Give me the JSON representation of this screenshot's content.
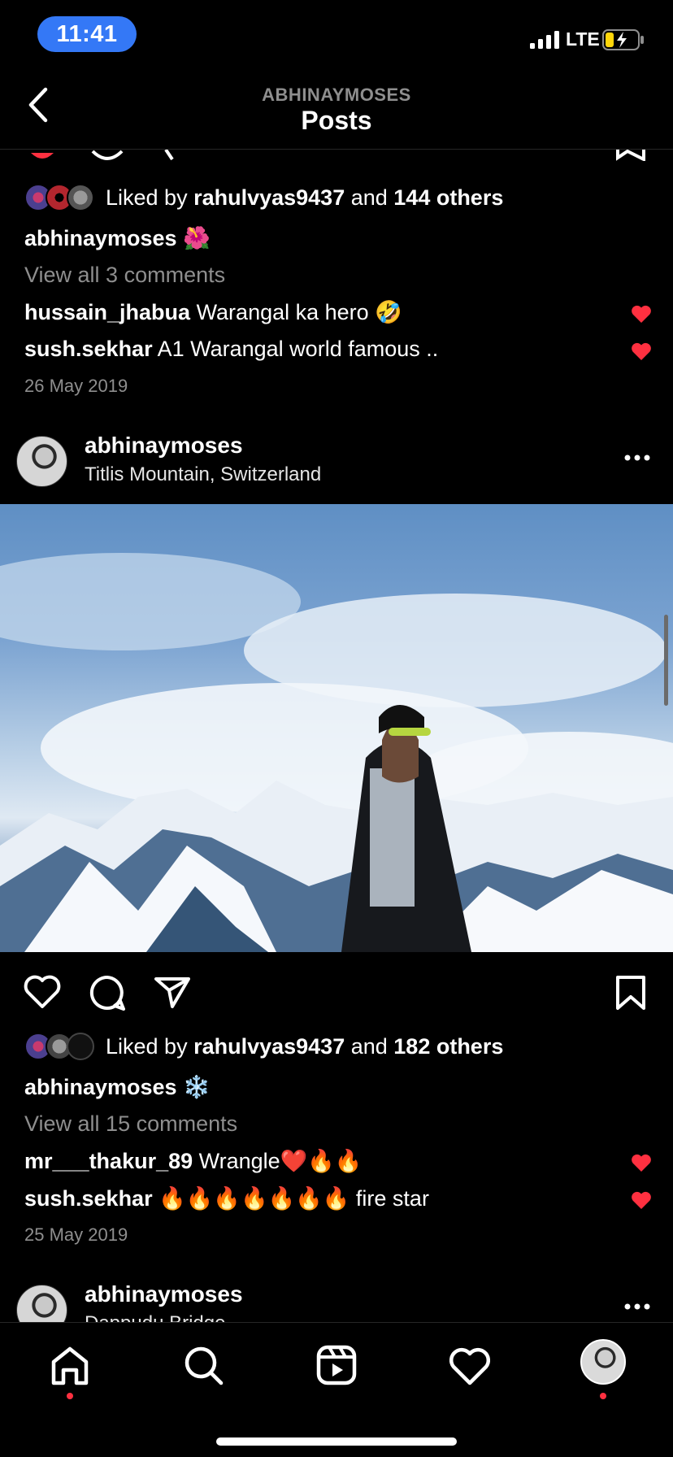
{
  "status": {
    "time": "11:41",
    "network": "LTE"
  },
  "nav": {
    "subtitle": "ABHINAYMOSES",
    "title": "Posts"
  },
  "post1": {
    "likes": {
      "prefix": "Liked by ",
      "user": "rahulvyas9437",
      "middle": " and ",
      "others": "144 others"
    },
    "caption": {
      "user": "abhinaymoses",
      "text": " 🌺"
    },
    "view_comments": "View all 3 comments",
    "comments": [
      {
        "user": "hussain_jhabua",
        "text": " Warangal ka hero 🤣"
      },
      {
        "user": "sush.sekhar",
        "text": " A1 Warangal world famous .."
      }
    ],
    "date": "26 May 2019"
  },
  "post2": {
    "user": "abhinaymoses",
    "location": "Titlis Mountain, Switzerland",
    "likes": {
      "prefix": "Liked by ",
      "user": "rahulvyas9437",
      "middle": " and ",
      "others": "182 others"
    },
    "caption": {
      "user": "abhinaymoses",
      "text": " ❄️"
    },
    "view_comments": "View all 15 comments",
    "comments": [
      {
        "user": "mr___thakur_89",
        "text": " Wrangle❤️🔥🔥"
      },
      {
        "user": "sush.sekhar",
        "text": " 🔥🔥🔥🔥🔥🔥🔥 fire star"
      }
    ],
    "date": "25 May 2019"
  },
  "post3": {
    "user": "abhinaymoses",
    "location": "Dappudu Bridge"
  },
  "colors": {
    "like_red": "#ff3040",
    "accent_blue": "#3478f6",
    "background": "#000000"
  },
  "icons": [
    "back-chevron-icon",
    "heart-icon",
    "comment-icon",
    "share-icon",
    "bookmark-icon",
    "more-icon",
    "home-icon",
    "search-icon",
    "reels-icon",
    "activity-heart-icon"
  ]
}
